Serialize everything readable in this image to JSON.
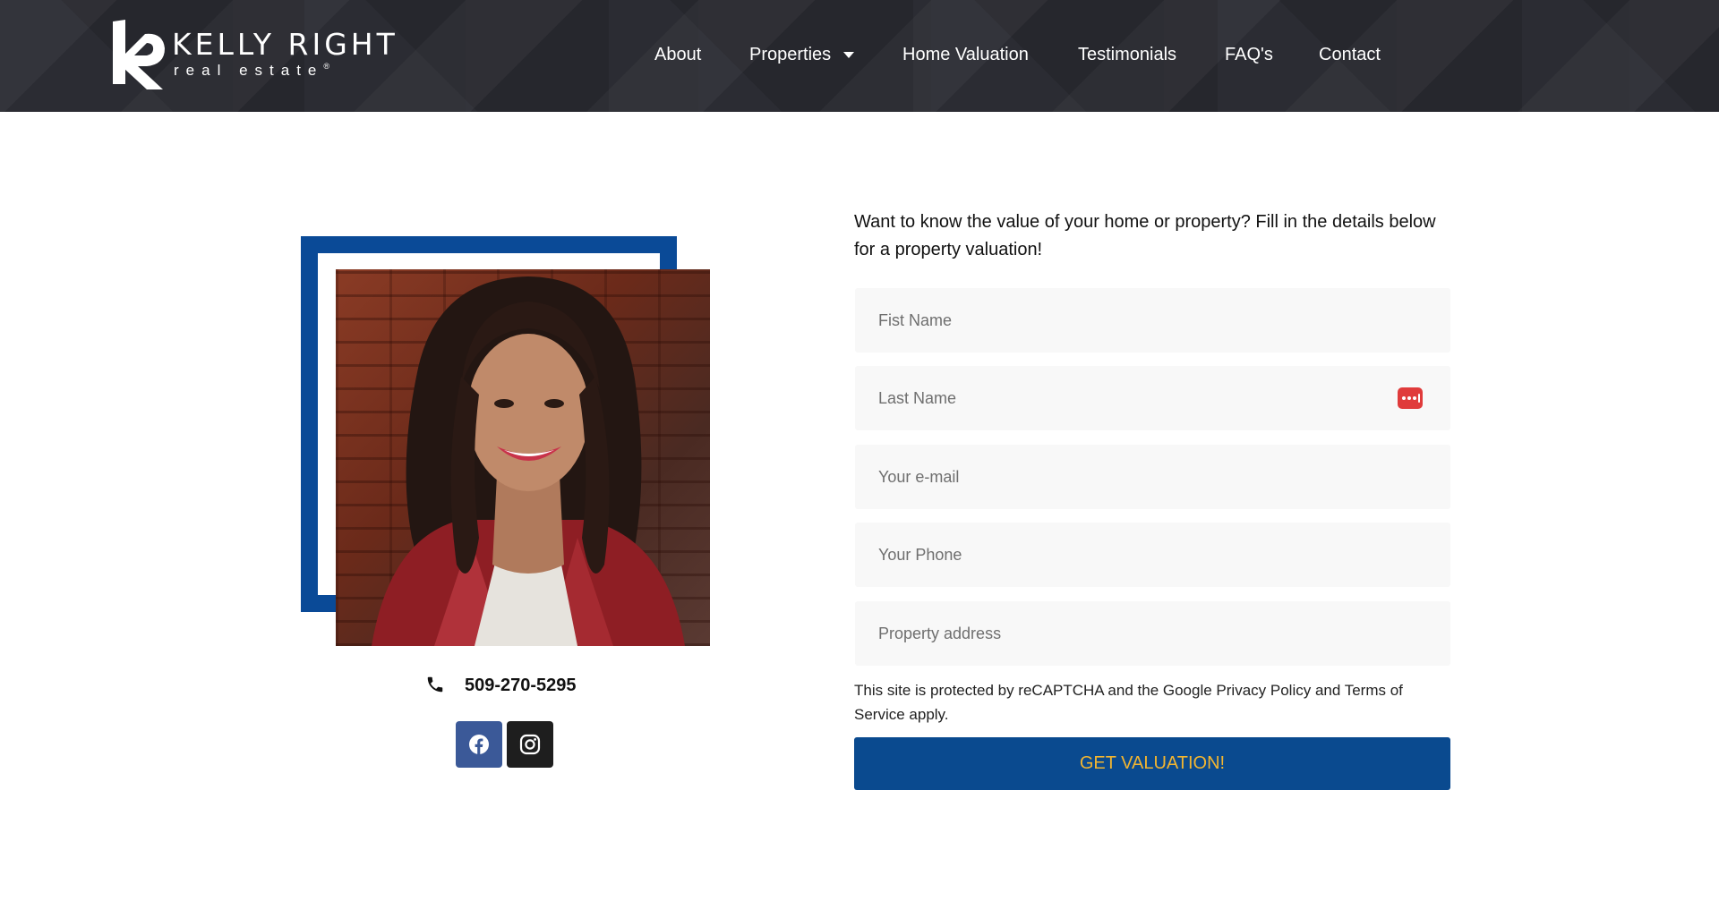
{
  "brand": {
    "name": "KELLY RIGHT",
    "sub": "real estate"
  },
  "nav": {
    "about": "About",
    "properties": "Properties",
    "home_valuation": "Home Valuation",
    "testimonials": "Testimonials",
    "faqs": "FAQ's",
    "contact": "Contact"
  },
  "agent": {
    "phone": "509-270-5295",
    "social": [
      "facebook-icon",
      "instagram-icon"
    ]
  },
  "form": {
    "intro": "Want to know the value of your home or property? Fill in the details below for a property valuation!",
    "first_name_placeholder": "Fist Name",
    "last_name_placeholder": "Last Name",
    "email_placeholder": "Your e-mail",
    "phone_placeholder": "Your Phone",
    "address_placeholder": "Property address",
    "recaptcha_notice": "This site is protected by reCAPTCHA and the Google Privacy Policy and Terms of Service apply.",
    "submit_label": "GET VALUATION!"
  },
  "colors": {
    "header_bg": "#2b2c33",
    "brand_blue": "#0a4a97",
    "button_text": "#f2b531",
    "facebook": "#3b5998",
    "password_manager": "#e03b3b"
  }
}
